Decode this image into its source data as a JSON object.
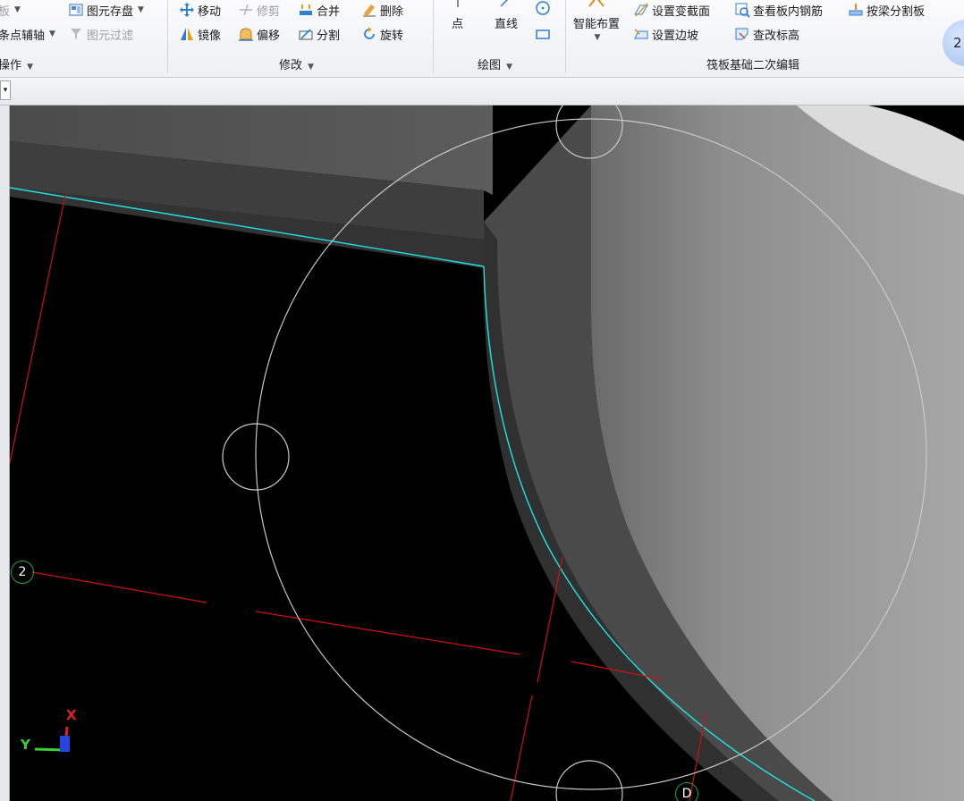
{
  "ribbon": {
    "group_operate": {
      "item_board_partial": "板",
      "item_axis_partial": "条点辅轴",
      "item_save_element": "图元存盘",
      "item_filter_element": "图元过滤",
      "label_partial": "操作"
    },
    "group_modify": {
      "move": "移动",
      "trim": "修剪",
      "merge": "合并",
      "delete": "删除",
      "mirror": "镜像",
      "offset": "偏移",
      "split": "分割",
      "rotate": "旋转",
      "label": "修改"
    },
    "group_draw": {
      "point": "点",
      "line": "直线",
      "label": "绘图"
    },
    "group_raft_edit": {
      "smart_layout": "智能布置",
      "set_variable_section": "设置变截面",
      "view_board_rebar": "查看板内钢筋",
      "split_by_beam": "按梁分割板",
      "set_edge_slope": "设置边坡",
      "check_elevation": "查改标高",
      "label": "筏板基础二次编辑"
    },
    "help_badge": "2"
  },
  "viewport": {
    "axis_x": "X",
    "axis_y": "Y",
    "grid_2": "2",
    "grid_d": "D"
  },
  "colors": {
    "outline": "#1ee3e3",
    "axis_line": "#d01010",
    "bubble": "#2fa43a"
  }
}
